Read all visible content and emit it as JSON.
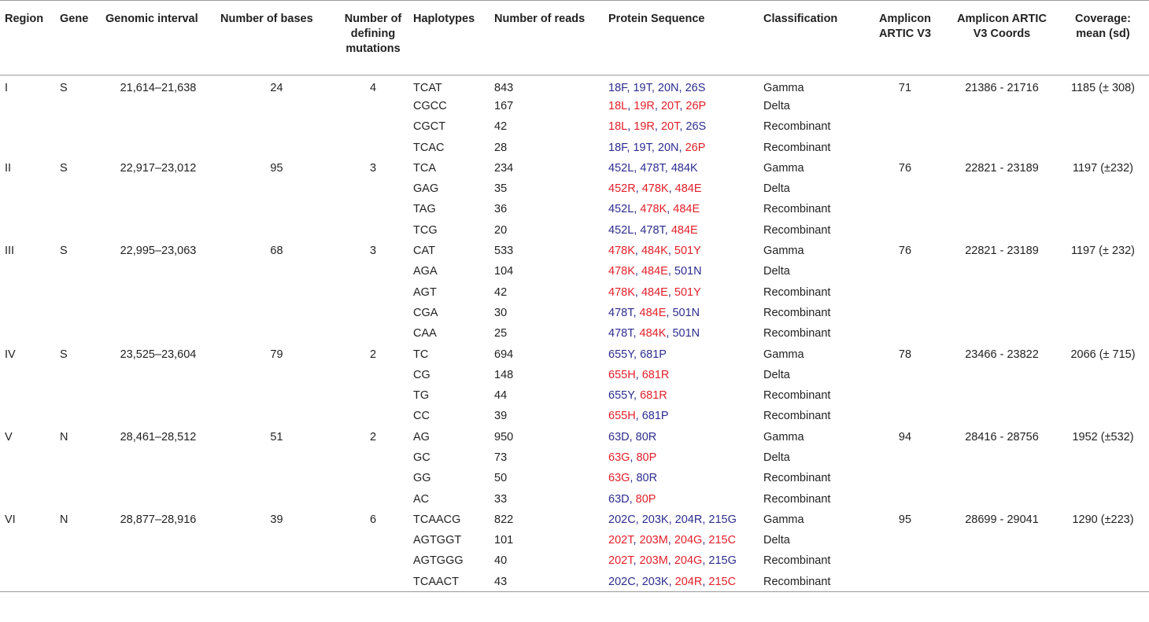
{
  "colors": {
    "blue": "#2d2d8f",
    "red": "#e2202a",
    "rule": "#9a9a9a",
    "text": "#222222"
  },
  "headers": [
    "Region",
    "Gene",
    "Genomic interval",
    "Number of bases",
    "Number of defining mutations",
    "Haplotypes",
    "Number of reads",
    "Protein Sequence",
    "Classification",
    "Amplicon ARTIC V3",
    "Amplicon ARTIC V3 Coords",
    "Coverage: mean (sd)"
  ],
  "rows": [
    {
      "region": "I",
      "gene": "S",
      "interval": "21,614–21,638",
      "bases": "24",
      "mutations": "4",
      "haplotype": "TCAT",
      "reads": "843",
      "protein": [
        {
          "t": "18F",
          "c": "blue"
        },
        {
          "t": "19T",
          "c": "blue"
        },
        {
          "t": "20N",
          "c": "blue"
        },
        {
          "t": "26S",
          "c": "blue"
        }
      ],
      "classification": "Gamma",
      "amplicon": "71",
      "coords": "21386 - 21716",
      "coverage": "1185 (± 308)"
    },
    {
      "region": "",
      "gene": "",
      "interval": "",
      "bases": "",
      "mutations": "",
      "haplotype": "CGCC",
      "reads": "167",
      "protein": [
        {
          "t": "18L",
          "c": "red"
        },
        {
          "t": "19R",
          "c": "red"
        },
        {
          "t": "20T",
          "c": "red"
        },
        {
          "t": "26P",
          "c": "red"
        }
      ],
      "classification": "Delta",
      "amplicon": "",
      "coords": "",
      "coverage": ""
    },
    {
      "region": "",
      "gene": "",
      "interval": "",
      "bases": "",
      "mutations": "",
      "haplotype": "CGCT",
      "reads": "42",
      "protein": [
        {
          "t": "18L",
          "c": "red"
        },
        {
          "t": "19R",
          "c": "red"
        },
        {
          "t": "20T",
          "c": "red"
        },
        {
          "t": "26S",
          "c": "blue"
        }
      ],
      "classification": "Recombinant",
      "amplicon": "",
      "coords": "",
      "coverage": ""
    },
    {
      "region": "",
      "gene": "",
      "interval": "",
      "bases": "",
      "mutations": "",
      "haplotype": "TCAC",
      "reads": "28",
      "protein": [
        {
          "t": "18F",
          "c": "blue"
        },
        {
          "t": "19T",
          "c": "blue"
        },
        {
          "t": "20N",
          "c": "blue"
        },
        {
          "t": "26P",
          "c": "red"
        }
      ],
      "classification": "Recombinant",
      "amplicon": "",
      "coords": "",
      "coverage": ""
    },
    {
      "region": "II",
      "gene": "S",
      "interval": "22,917–23,012",
      "bases": "95",
      "mutations": "3",
      "haplotype": "TCA",
      "reads": "234",
      "protein": [
        {
          "t": "452L",
          "c": "blue"
        },
        {
          "t": "478T",
          "c": "blue"
        },
        {
          "t": "484K",
          "c": "blue"
        }
      ],
      "classification": "Gamma",
      "amplicon": "76",
      "coords": "22821 - 23189",
      "coverage": "1197 (±232)"
    },
    {
      "region": "",
      "gene": "",
      "interval": "",
      "bases": "",
      "mutations": "",
      "haplotype": "GAG",
      "reads": "35",
      "protein": [
        {
          "t": "452R",
          "c": "red"
        },
        {
          "t": "478K",
          "c": "red"
        },
        {
          "t": "484E",
          "c": "red"
        }
      ],
      "classification": "Delta",
      "amplicon": "",
      "coords": "",
      "coverage": ""
    },
    {
      "region": "",
      "gene": "",
      "interval": "",
      "bases": "",
      "mutations": "",
      "haplotype": "TAG",
      "reads": "36",
      "protein": [
        {
          "t": "452L",
          "c": "blue"
        },
        {
          "t": "478K",
          "c": "red"
        },
        {
          "t": "484E",
          "c": "red"
        }
      ],
      "classification": "Recombinant",
      "amplicon": "",
      "coords": "",
      "coverage": ""
    },
    {
      "region": "",
      "gene": "",
      "interval": "",
      "bases": "",
      "mutations": "",
      "haplotype": "TCG",
      "reads": "20",
      "protein": [
        {
          "t": "452L",
          "c": "blue"
        },
        {
          "t": "478T",
          "c": "blue"
        },
        {
          "t": "484E",
          "c": "red"
        }
      ],
      "classification": "Recombinant",
      "amplicon": "",
      "coords": "",
      "coverage": ""
    },
    {
      "region": "III",
      "gene": "S",
      "interval": "22,995–23,063",
      "bases": "68",
      "mutations": "3",
      "haplotype": "CAT",
      "reads": "533",
      "protein": [
        {
          "t": "478K",
          "c": "red"
        },
        {
          "t": "484K",
          "c": "red"
        },
        {
          "t": "501Y",
          "c": "red"
        }
      ],
      "classification": "Gamma",
      "amplicon": "76",
      "coords": "22821 - 23189",
      "coverage": "1197 (± 232)"
    },
    {
      "region": "",
      "gene": "",
      "interval": "",
      "bases": "",
      "mutations": "",
      "haplotype": "AGA",
      "reads": "104",
      "protein": [
        {
          "t": "478K",
          "c": "red"
        },
        {
          "t": "484E",
          "c": "red"
        },
        {
          "t": "501N",
          "c": "blue"
        }
      ],
      "classification": "Delta",
      "amplicon": "",
      "coords": "",
      "coverage": ""
    },
    {
      "region": "",
      "gene": "",
      "interval": "",
      "bases": "",
      "mutations": "",
      "haplotype": "AGT",
      "reads": "42",
      "protein": [
        {
          "t": "478K",
          "c": "red"
        },
        {
          "t": "484E",
          "c": "red"
        },
        {
          "t": "501Y",
          "c": "red"
        }
      ],
      "classification": "Recombinant",
      "amplicon": "",
      "coords": "",
      "coverage": ""
    },
    {
      "region": "",
      "gene": "",
      "interval": "",
      "bases": "",
      "mutations": "",
      "haplotype": "CGA",
      "reads": "30",
      "protein": [
        {
          "t": "478T",
          "c": "blue"
        },
        {
          "t": "484E",
          "c": "red"
        },
        {
          "t": "501N",
          "c": "blue"
        }
      ],
      "classification": "Recombinant",
      "amplicon": "",
      "coords": "",
      "coverage": ""
    },
    {
      "region": "",
      "gene": "",
      "interval": "",
      "bases": "",
      "mutations": "",
      "haplotype": "CAA",
      "reads": "25",
      "protein": [
        {
          "t": "478T",
          "c": "blue"
        },
        {
          "t": "484K",
          "c": "red"
        },
        {
          "t": "501N",
          "c": "blue"
        }
      ],
      "classification": "Recombinant",
      "amplicon": "",
      "coords": "",
      "coverage": ""
    },
    {
      "region": "IV",
      "gene": "S",
      "interval": "23,525–23,604",
      "bases": "79",
      "mutations": "2",
      "haplotype": "TC",
      "reads": "694",
      "protein": [
        {
          "t": "655Y",
          "c": "blue"
        },
        {
          "t": "681P",
          "c": "blue"
        }
      ],
      "classification": "Gamma",
      "amplicon": "78",
      "coords": "23466 - 23822",
      "coverage": "2066 (± 715)"
    },
    {
      "region": "",
      "gene": "",
      "interval": "",
      "bases": "",
      "mutations": "",
      "haplotype": "CG",
      "reads": "148",
      "protein": [
        {
          "t": "655H",
          "c": "red"
        },
        {
          "t": "681R",
          "c": "red"
        }
      ],
      "classification": "Delta",
      "amplicon": "",
      "coords": "",
      "coverage": ""
    },
    {
      "region": "",
      "gene": "",
      "interval": "",
      "bases": "",
      "mutations": "",
      "haplotype": "TG",
      "reads": "44",
      "protein": [
        {
          "t": "655Y",
          "c": "blue"
        },
        {
          "t": "681R",
          "c": "red"
        }
      ],
      "classification": "Recombinant",
      "amplicon": "",
      "coords": "",
      "coverage": ""
    },
    {
      "region": "",
      "gene": "",
      "interval": "",
      "bases": "",
      "mutations": "",
      "haplotype": "CC",
      "reads": "39",
      "protein": [
        {
          "t": "655H",
          "c": "red"
        },
        {
          "t": "681P",
          "c": "blue"
        }
      ],
      "classification": "Recombinant",
      "amplicon": "",
      "coords": "",
      "coverage": ""
    },
    {
      "region": "V",
      "gene": "N",
      "interval": "28,461–28,512",
      "bases": "51",
      "mutations": "2",
      "haplotype": "AG",
      "reads": "950",
      "protein": [
        {
          "t": "63D",
          "c": "blue"
        },
        {
          "t": "80R",
          "c": "blue"
        }
      ],
      "classification": "Gamma",
      "amplicon": "94",
      "coords": "28416 - 28756",
      "coverage": "1952 (±532)"
    },
    {
      "region": "",
      "gene": "",
      "interval": "",
      "bases": "",
      "mutations": "",
      "haplotype": "GC",
      "reads": "73",
      "protein": [
        {
          "t": "63G",
          "c": "red"
        },
        {
          "t": "80P",
          "c": "red"
        }
      ],
      "classification": "Delta",
      "amplicon": "",
      "coords": "",
      "coverage": ""
    },
    {
      "region": "",
      "gene": "",
      "interval": "",
      "bases": "",
      "mutations": "",
      "haplotype": "GG",
      "reads": "50",
      "protein": [
        {
          "t": "63G",
          "c": "red"
        },
        {
          "t": "80R",
          "c": "blue"
        }
      ],
      "classification": "Recombinant",
      "amplicon": "",
      "coords": "",
      "coverage": ""
    },
    {
      "region": "",
      "gene": "",
      "interval": "",
      "bases": "",
      "mutations": "",
      "haplotype": "AC",
      "reads": "33",
      "protein": [
        {
          "t": "63D",
          "c": "blue"
        },
        {
          "t": "80P",
          "c": "red"
        }
      ],
      "classification": "Recombinant",
      "amplicon": "",
      "coords": "",
      "coverage": ""
    },
    {
      "region": "VI",
      "gene": "N",
      "interval": "28,877–28,916",
      "bases": "39",
      "mutations": "6",
      "haplotype": "TCAACG",
      "reads": "822",
      "protein": [
        {
          "t": "202C",
          "c": "blue"
        },
        {
          "t": "203K",
          "c": "blue"
        },
        {
          "t": "204R",
          "c": "blue"
        },
        {
          "t": "215G",
          "c": "blue"
        }
      ],
      "classification": "Gamma",
      "amplicon": "95",
      "coords": "28699 - 29041",
      "coverage": "1290 (±223)"
    },
    {
      "region": "",
      "gene": "",
      "interval": "",
      "bases": "",
      "mutations": "",
      "haplotype": "AGTGGT",
      "reads": "101",
      "protein": [
        {
          "t": "202T",
          "c": "red"
        },
        {
          "t": "203M",
          "c": "red"
        },
        {
          "t": "204G",
          "c": "red"
        },
        {
          "t": "215C",
          "c": "red"
        }
      ],
      "classification": "Delta",
      "amplicon": "",
      "coords": "",
      "coverage": ""
    },
    {
      "region": "",
      "gene": "",
      "interval": "",
      "bases": "",
      "mutations": "",
      "haplotype": "AGTGGG",
      "reads": "40",
      "protein": [
        {
          "t": "202T",
          "c": "red"
        },
        {
          "t": "203M",
          "c": "red"
        },
        {
          "t": "204G",
          "c": "red"
        },
        {
          "t": "215G",
          "c": "blue"
        }
      ],
      "classification": "Recombinant",
      "amplicon": "",
      "coords": "",
      "coverage": ""
    },
    {
      "region": "",
      "gene": "",
      "interval": "",
      "bases": "",
      "mutations": "",
      "haplotype": "TCAACT",
      "reads": "43",
      "protein": [
        {
          "t": "202C",
          "c": "blue"
        },
        {
          "t": "203K",
          "c": "blue"
        },
        {
          "t": "204R",
          "c": "red"
        },
        {
          "t": "215C",
          "c": "red"
        }
      ],
      "classification": "Recombinant",
      "amplicon": "",
      "coords": "",
      "coverage": ""
    }
  ]
}
